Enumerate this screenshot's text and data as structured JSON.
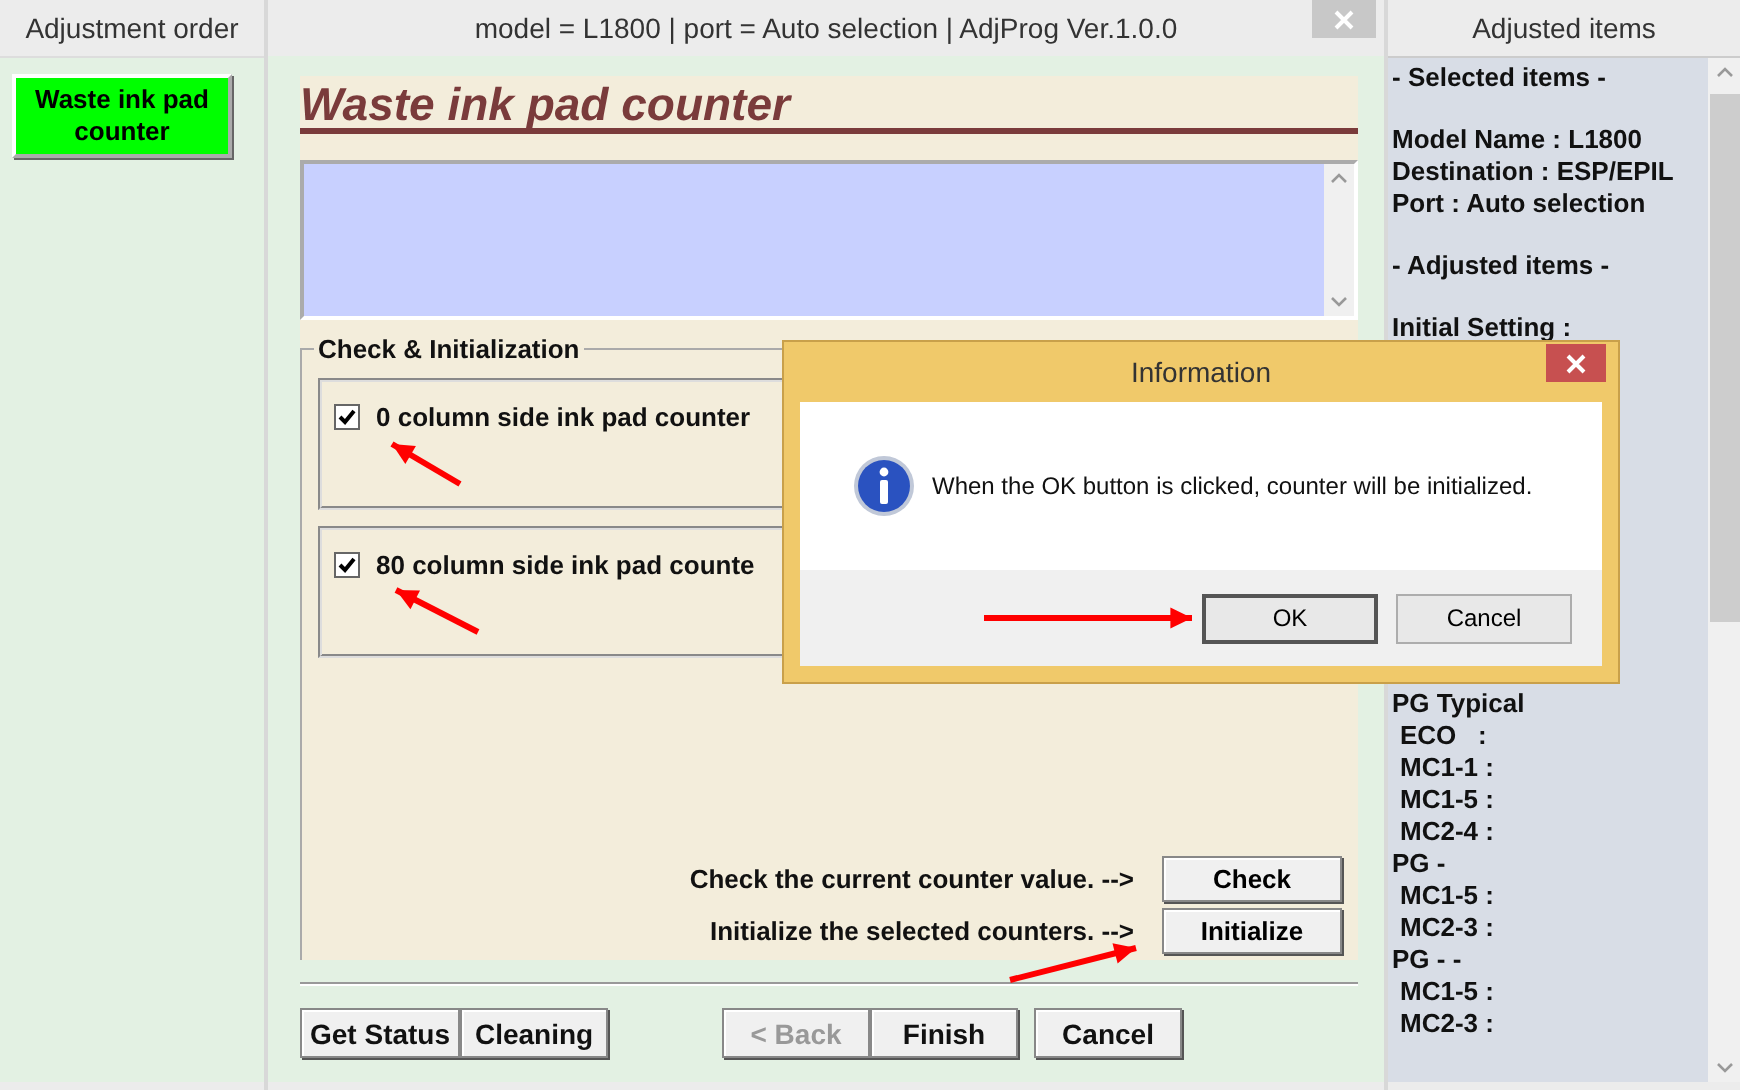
{
  "headers": {
    "left": "Adjustment order",
    "center": "model = L1800 | port = Auto selection | AdjProg Ver.1.0.0",
    "right": "Adjusted items"
  },
  "sidebar": {
    "items": [
      {
        "label": "Waste ink pad counter",
        "selected": true
      }
    ]
  },
  "main": {
    "heading": "Waste ink pad counter",
    "group_title": "Check & Initialization",
    "counters": [
      {
        "label": "0 column side ink pad counter",
        "checked": true
      },
      {
        "label": "80 column side ink pad counte",
        "checked": true
      }
    ],
    "actions": [
      {
        "label": "Check the current counter value. -->",
        "button": "Check"
      },
      {
        "label": "Initialize the selected counters. -->",
        "button": "Initialize"
      }
    ],
    "footer_groups": [
      [
        {
          "label": "Get Status",
          "disabled": false
        },
        {
          "label": "Cleaning",
          "disabled": false
        }
      ],
      [
        {
          "label": "< Back",
          "disabled": true
        },
        {
          "label": "Finish",
          "disabled": false
        }
      ],
      [
        {
          "label": "Cancel",
          "disabled": false
        }
      ]
    ]
  },
  "adjusted": {
    "sections": [
      [
        {
          "text": "- Selected items -",
          "indent": false
        }
      ],
      [
        {
          "text": "Model Name : L1800",
          "indent": false
        },
        {
          "text": "Destination : ESP/EPIL",
          "indent": false
        },
        {
          "text": "Port : Auto selection",
          "indent": false
        }
      ],
      [
        {
          "text": "- Adjusted items -",
          "indent": false
        }
      ],
      [
        {
          "text": "Initial Setting :",
          "indent": false
        }
      ]
    ],
    "lower_lines": [
      {
        "text": "PG Typical",
        "indent": false
      },
      {
        "text": "ECO   :",
        "indent": true
      },
      {
        "text": "MC1-1 :",
        "indent": true
      },
      {
        "text": "MC1-5 :",
        "indent": true
      },
      {
        "text": "MC2-4 :",
        "indent": true
      },
      {
        "text": "PG -",
        "indent": false
      },
      {
        "text": "MC1-5 :",
        "indent": true
      },
      {
        "text": "MC2-3 :",
        "indent": true
      },
      {
        "text": "PG - -",
        "indent": false
      },
      {
        "text": "MC1-5 :",
        "indent": true
      },
      {
        "text": "MC2-3 :",
        "indent": true
      }
    ]
  },
  "dialog": {
    "title": "Information",
    "message": "When the OK button is clicked, counter will be initialized.",
    "buttons": [
      {
        "label": "OK",
        "focused": true
      },
      {
        "label": "Cancel",
        "focused": false
      }
    ]
  }
}
